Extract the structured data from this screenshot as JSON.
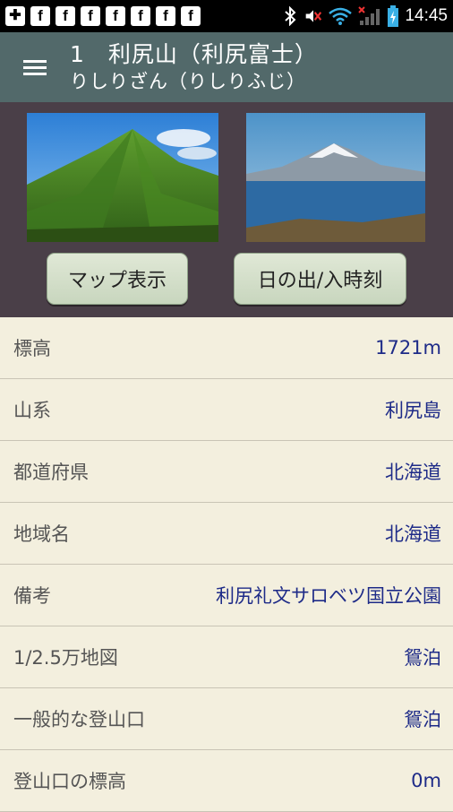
{
  "status_bar": {
    "time": "14:45",
    "notification_icons": [
      "f",
      "f",
      "f",
      "f",
      "f",
      "f",
      "f"
    ]
  },
  "header": {
    "title": "1　利尻山（利尻富士）",
    "subtitle": "りしりざん（りしりふじ）"
  },
  "buttons": {
    "map_label": "マップ表示",
    "sun_label": "日の出/入時刻"
  },
  "details": [
    {
      "label": "標高",
      "value": "1721m"
    },
    {
      "label": "山系",
      "value": "利尻島"
    },
    {
      "label": "都道府県",
      "value": "北海道"
    },
    {
      "label": "地域名",
      "value": "北海道"
    },
    {
      "label": "備考",
      "value": "利尻礼文サロベツ国立公園"
    },
    {
      "label": "1/2.5万地図",
      "value": "鴛泊"
    },
    {
      "label": "一般的な登山口",
      "value": "鴛泊"
    },
    {
      "label": "登山口の標高",
      "value": "0m"
    }
  ]
}
